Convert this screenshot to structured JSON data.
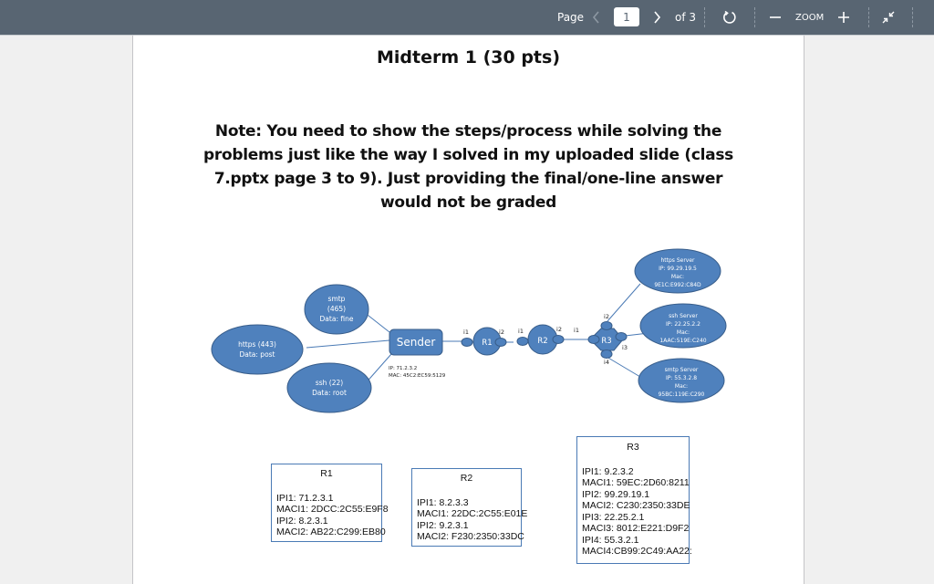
{
  "toolbar": {
    "page_label": "Page",
    "current_page": "1",
    "of_label": "of 3",
    "zoom_label": "ZOOM",
    "icons": {
      "prev": "chevron-left-icon",
      "next": "chevron-right-icon",
      "rotate": "rotate-icon",
      "zoom_out": "minus-icon",
      "zoom_in": "plus-icon",
      "collapse": "collapse-arrows-icon"
    }
  },
  "document": {
    "title": "Midterm 1 (30 pts)",
    "note": "Note: You need to show the steps/process while solving the problems just like the way I solved in my uploaded slide (class 7.pptx page 3 to 9). Just providing the final/one-line answer would not be graded"
  },
  "diagram": {
    "colors": {
      "node_fill": "#4f81bd",
      "node_stroke": "#385d8a",
      "link": "#4a7ab5",
      "box_border": "#4a7ab5"
    },
    "sender": {
      "label": "Sender",
      "ip": "IP: 71.2.3.2",
      "mac": "MAC: 45C2:EC59:5129"
    },
    "apps": [
      {
        "lines": [
          "smtp",
          "(465)",
          "Data: fine"
        ]
      },
      {
        "lines": [
          "https (443)",
          "Data: post"
        ]
      },
      {
        "lines": [
          "ssh (22)",
          "Data: root"
        ]
      }
    ],
    "routers": [
      {
        "label": "R1",
        "if_left": "i1",
        "if_right": "i2"
      },
      {
        "label": "R2",
        "if_left": "i1",
        "if_right": "i2"
      },
      {
        "label": "R3",
        "if_left": "i1",
        "if_top": "i2",
        "if_right": "i3",
        "if_bottom": "i4"
      }
    ],
    "servers": [
      {
        "lines": [
          "https Server",
          "IP: 99.29.19.5",
          "Mac:",
          "9E1C:E992:C84D"
        ]
      },
      {
        "lines": [
          "ssh Server",
          "IP: 22.25.2.2",
          "Mac:",
          "1AAC:519E:C240"
        ]
      },
      {
        "lines": [
          "smtp Server",
          "IP: 55.3.2.8",
          "Mac:",
          "95BC:119E:C290"
        ]
      }
    ]
  },
  "router_tables": [
    {
      "title": "R1",
      "lines": [
        "IPI1: 71.2.3.1",
        "MACI1: 2DCC:2C55:E9F8",
        "IPI2: 8.2.3.1",
        "MACI2: AB22:C299:EB80"
      ]
    },
    {
      "title": "R2",
      "lines": [
        "IPI1: 8.2.3.3",
        "MACI1: 22DC:2C55:E01E",
        "IPI2: 9.2.3.1",
        "MACI2: F230:2350:33DC"
      ]
    },
    {
      "title": "R3",
      "lines": [
        "IPI1: 9.2.3.2",
        "MACI1: 59EC:2D60:8211",
        "IPI2: 99.29.19.1",
        "MACI2: C230:2350:33DE",
        "IPI3: 22.25.2.1",
        "MACI3: 8012:E221:D9F2",
        "IPI4: 55.3.2.1",
        "MACI4:CB99:2C49:AA22:"
      ]
    }
  ]
}
